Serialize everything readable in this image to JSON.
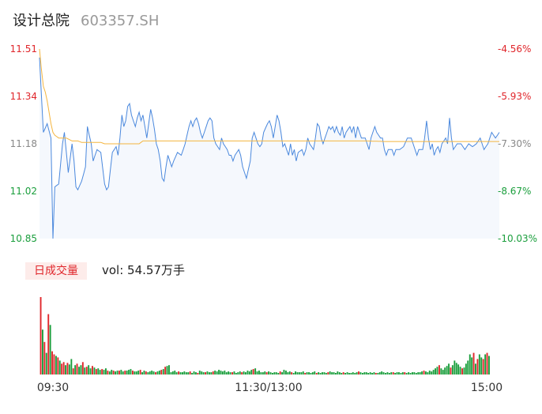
{
  "header": {
    "name": "设计总院",
    "code": "603357.SH"
  },
  "volume_panel": {
    "tab_label": "日成交量",
    "vol_label": "vol: 54.57万手"
  },
  "colors": {
    "price_line": "#4a88dd",
    "avg_line": "#f4b53f",
    "up": "#e0262b",
    "down": "#1a9e3c",
    "area_fill": "#f5f8fd"
  },
  "chart_data": [
    {
      "type": "line",
      "name": "intraday-price",
      "ylim": [
        10.85,
        11.51
      ],
      "pct_range": [
        -10.03,
        -4.56
      ],
      "y_ticks": [
        "11.51",
        "11.34",
        "11.18",
        "11.02",
        "10.85"
      ],
      "pct_ticks": [
        "-4.56%",
        "-5.93%",
        "-7.30%",
        "-8.67%",
        "-10.03%"
      ],
      "x_ticks": [
        "09:30",
        "11:30/13:00",
        "15:00"
      ],
      "total_minutes": 240,
      "price_keypoints": [
        [
          0,
          11.48
        ],
        [
          2,
          11.22
        ],
        [
          4,
          11.25
        ],
        [
          6,
          11.2
        ],
        [
          7,
          10.85
        ],
        [
          8,
          11.03
        ],
        [
          10,
          11.04
        ],
        [
          12,
          11.18
        ],
        [
          13,
          11.22
        ],
        [
          14,
          11.15
        ],
        [
          15,
          11.08
        ],
        [
          17,
          11.18
        ],
        [
          18,
          11.12
        ],
        [
          19,
          11.03
        ],
        [
          20,
          11.02
        ],
        [
          22,
          11.05
        ],
        [
          24,
          11.1
        ],
        [
          25,
          11.24
        ],
        [
          27,
          11.18
        ],
        [
          28,
          11.12
        ],
        [
          30,
          11.16
        ],
        [
          32,
          11.15
        ],
        [
          34,
          11.04
        ],
        [
          35,
          11.02
        ],
        [
          36,
          11.03
        ],
        [
          38,
          11.15
        ],
        [
          40,
          11.17
        ],
        [
          41,
          11.14
        ],
        [
          42,
          11.2
        ],
        [
          43,
          11.28
        ],
        [
          44,
          11.24
        ],
        [
          45,
          11.26
        ],
        [
          46,
          11.31
        ],
        [
          47,
          11.32
        ],
        [
          48,
          11.28
        ],
        [
          49,
          11.26
        ],
        [
          50,
          11.24
        ],
        [
          51,
          11.27
        ],
        [
          52,
          11.29
        ],
        [
          53,
          11.26
        ],
        [
          54,
          11.28
        ],
        [
          56,
          11.2
        ],
        [
          57,
          11.25
        ],
        [
          58,
          11.3
        ],
        [
          59,
          11.27
        ],
        [
          60,
          11.23
        ],
        [
          61,
          11.18
        ],
        [
          62,
          11.16
        ],
        [
          63,
          11.12
        ],
        [
          64,
          11.06
        ],
        [
          65,
          11.05
        ],
        [
          66,
          11.1
        ],
        [
          67,
          11.14
        ],
        [
          68,
          11.12
        ],
        [
          69,
          11.1
        ],
        [
          70,
          11.12
        ],
        [
          72,
          11.15
        ],
        [
          74,
          11.14
        ],
        [
          76,
          11.18
        ],
        [
          78,
          11.24
        ],
        [
          79,
          11.26
        ],
        [
          80,
          11.24
        ],
        [
          81,
          11.26
        ],
        [
          82,
          11.27
        ],
        [
          83,
          11.25
        ],
        [
          84,
          11.22
        ],
        [
          85,
          11.2
        ],
        [
          86,
          11.22
        ],
        [
          87,
          11.24
        ],
        [
          88,
          11.26
        ],
        [
          89,
          11.27
        ],
        [
          90,
          11.26
        ],
        [
          91,
          11.2
        ],
        [
          92,
          11.18
        ],
        [
          94,
          11.16
        ],
        [
          95,
          11.2
        ],
        [
          96,
          11.18
        ],
        [
          98,
          11.16
        ],
        [
          99,
          11.14
        ],
        [
          100,
          11.14
        ],
        [
          101,
          11.12
        ],
        [
          102,
          11.14
        ],
        [
          104,
          11.16
        ],
        [
          105,
          11.14
        ],
        [
          106,
          11.1
        ],
        [
          107,
          11.08
        ],
        [
          108,
          11.06
        ],
        [
          110,
          11.12
        ],
        [
          111,
          11.2
        ],
        [
          112,
          11.22
        ],
        [
          113,
          11.2
        ],
        [
          114,
          11.18
        ],
        [
          115,
          11.17
        ],
        [
          116,
          11.18
        ],
        [
          117,
          11.22
        ],
        [
          119,
          11.25
        ],
        [
          120,
          11.26
        ],
        [
          121,
          11.24
        ],
        [
          122,
          11.2
        ],
        [
          123,
          11.24
        ],
        [
          124,
          11.28
        ],
        [
          125,
          11.26
        ],
        [
          126,
          11.22
        ],
        [
          127,
          11.17
        ],
        [
          128,
          11.18
        ],
        [
          129,
          11.16
        ],
        [
          130,
          11.14
        ],
        [
          131,
          11.18
        ],
        [
          132,
          11.14
        ],
        [
          133,
          11.16
        ],
        [
          134,
          11.12
        ],
        [
          135,
          11.15
        ],
        [
          137,
          11.16
        ],
        [
          138,
          11.14
        ],
        [
          139,
          11.16
        ],
        [
          140,
          11.2
        ],
        [
          141,
          11.18
        ],
        [
          142,
          11.17
        ],
        [
          143,
          11.16
        ],
        [
          144,
          11.2
        ],
        [
          145,
          11.25
        ],
        [
          146,
          11.24
        ],
        [
          147,
          11.2
        ],
        [
          148,
          11.18
        ],
        [
          150,
          11.22
        ],
        [
          151,
          11.24
        ],
        [
          152,
          11.23
        ],
        [
          153,
          11.24
        ],
        [
          154,
          11.22
        ],
        [
          155,
          11.24
        ],
        [
          156,
          11.22
        ],
        [
          157,
          11.21
        ],
        [
          158,
          11.24
        ],
        [
          159,
          11.2
        ],
        [
          160,
          11.22
        ],
        [
          162,
          11.24
        ],
        [
          163,
          11.22
        ],
        [
          164,
          11.24
        ],
        [
          165,
          11.2
        ],
        [
          166,
          11.24
        ],
        [
          167,
          11.22
        ],
        [
          168,
          11.2
        ],
        [
          170,
          11.2
        ],
        [
          171,
          11.18
        ],
        [
          172,
          11.16
        ],
        [
          173,
          11.2
        ],
        [
          174,
          11.22
        ],
        [
          175,
          11.24
        ],
        [
          176,
          11.22
        ],
        [
          178,
          11.2
        ],
        [
          179,
          11.2
        ],
        [
          180,
          11.16
        ],
        [
          181,
          11.14
        ],
        [
          182,
          11.16
        ],
        [
          184,
          11.16
        ],
        [
          185,
          11.14
        ],
        [
          186,
          11.16
        ],
        [
          188,
          11.16
        ],
        [
          190,
          11.17
        ],
        [
          192,
          11.2
        ],
        [
          194,
          11.2
        ],
        [
          195,
          11.18
        ],
        [
          196,
          11.16
        ],
        [
          197,
          11.14
        ],
        [
          198,
          11.16
        ],
        [
          200,
          11.16
        ],
        [
          201,
          11.2
        ],
        [
          202,
          11.26
        ],
        [
          203,
          11.2
        ],
        [
          204,
          11.16
        ],
        [
          205,
          11.18
        ],
        [
          206,
          11.14
        ],
        [
          207,
          11.16
        ],
        [
          208,
          11.17
        ],
        [
          209,
          11.15
        ],
        [
          210,
          11.18
        ],
        [
          212,
          11.2
        ],
        [
          213,
          11.18
        ],
        [
          214,
          11.27
        ],
        [
          215,
          11.2
        ],
        [
          216,
          11.16
        ],
        [
          218,
          11.18
        ],
        [
          220,
          11.18
        ],
        [
          222,
          11.16
        ],
        [
          224,
          11.18
        ],
        [
          226,
          11.17
        ],
        [
          228,
          11.18
        ],
        [
          230,
          11.2
        ],
        [
          232,
          11.16
        ],
        [
          234,
          11.18
        ],
        [
          236,
          11.22
        ],
        [
          238,
          11.2
        ],
        [
          240,
          11.22
        ]
      ],
      "avg_keypoints": [
        [
          0,
          11.51
        ],
        [
          1,
          11.44
        ],
        [
          2,
          11.38
        ],
        [
          3,
          11.36
        ],
        [
          4,
          11.33
        ],
        [
          5,
          11.29
        ],
        [
          6,
          11.25
        ],
        [
          7,
          11.22
        ],
        [
          8,
          11.21
        ],
        [
          10,
          11.2
        ],
        [
          14,
          11.2
        ],
        [
          17,
          11.19
        ],
        [
          20,
          11.19
        ],
        [
          22,
          11.185
        ],
        [
          32,
          11.185
        ],
        [
          34,
          11.18
        ],
        [
          40,
          11.18
        ],
        [
          44,
          11.18
        ],
        [
          52,
          11.18
        ],
        [
          54,
          11.19
        ],
        [
          80,
          11.19
        ],
        [
          140,
          11.19
        ],
        [
          170,
          11.19
        ],
        [
          180,
          11.188
        ],
        [
          240,
          11.188
        ]
      ]
    },
    {
      "type": "bar",
      "name": "volume",
      "ylim": [
        0,
        100
      ],
      "up_minutes": [
        0,
        2,
        4,
        6,
        7,
        9,
        11,
        12,
        14,
        17,
        19,
        22,
        24,
        27,
        29,
        32,
        35,
        38,
        41,
        44,
        48,
        52,
        55,
        60,
        63,
        65,
        72,
        78,
        82,
        86,
        90,
        100,
        105,
        111,
        118,
        125,
        131,
        138,
        144,
        150,
        158,
        166,
        175,
        184,
        190,
        200,
        208,
        214,
        220,
        226,
        228,
        231,
        233,
        235,
        236
      ],
      "volumes": [
        100,
        58,
        42,
        28,
        78,
        64,
        30,
        26,
        24,
        22,
        18,
        14,
        16,
        12,
        15,
        13,
        20,
        8,
        12,
        14,
        10,
        12,
        16,
        9,
        10,
        12,
        8,
        11,
        9,
        7,
        8,
        6,
        7,
        6,
        8,
        5,
        4,
        6,
        5,
        4,
        5,
        5,
        6,
        4,
        5,
        5,
        6,
        7,
        5,
        4,
        4,
        5,
        6,
        3,
        5,
        4,
        3,
        4,
        5,
        4,
        3,
        4,
        5,
        6,
        7,
        10,
        11,
        12,
        3,
        4,
        5,
        3,
        4,
        3,
        3,
        4,
        3,
        3,
        4,
        2,
        4,
        3,
        2,
        5,
        4,
        3,
        3,
        4,
        3,
        3,
        4,
        5,
        4,
        6,
        5,
        4,
        5,
        3,
        4,
        3,
        3,
        4,
        2,
        3,
        4,
        3,
        4,
        3,
        5,
        4,
        6,
        7,
        8,
        4,
        5,
        3,
        3,
        4,
        3,
        4,
        3,
        2,
        3,
        3,
        2,
        4,
        3,
        6,
        5,
        3,
        4,
        3,
        2,
        4,
        3,
        3,
        3,
        4,
        2,
        3,
        3,
        2,
        3,
        4,
        2,
        3,
        2,
        3,
        3,
        2,
        3,
        4,
        3,
        3,
        2,
        4,
        3,
        2,
        3,
        2,
        3,
        2,
        2,
        3,
        2,
        3,
        4,
        3,
        2,
        3,
        3,
        2,
        3,
        2,
        3,
        2,
        2,
        3,
        4,
        3,
        2,
        3,
        2,
        3,
        3,
        2,
        3,
        3,
        2,
        3,
        3,
        2,
        3,
        2,
        3,
        3,
        2,
        3,
        3,
        4,
        5,
        4,
        3,
        5,
        4,
        6,
        8,
        10,
        12,
        8,
        6,
        9,
        11,
        14,
        9,
        12,
        18,
        15,
        13,
        10,
        8,
        9,
        14,
        18,
        26,
        22,
        28,
        14,
        20,
        26,
        22,
        20,
        26,
        28,
        24
      ]
    }
  ]
}
